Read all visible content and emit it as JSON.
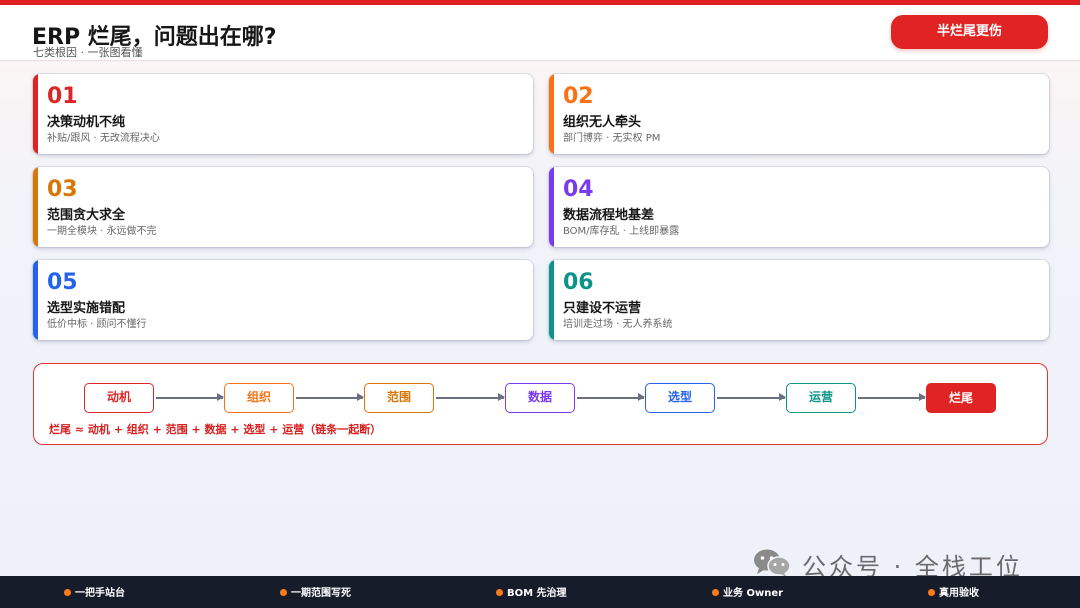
{
  "header": {
    "title": "ERP 烂尾，问题出在哪?",
    "subtitle": "七类根因 · 一张图看懂",
    "button_label": "半烂尾更伤"
  },
  "colors": {
    "accent_red": "#e02424",
    "card_01": "#dc2626",
    "card_02": "#f97316",
    "card_03": "#d97706",
    "card_04": "#7c3aed",
    "card_05": "#2563eb",
    "card_06": "#0d9488"
  },
  "cards": [
    {
      "num": "01",
      "title": "决策动机不纯",
      "desc": "补贴/跟风 · 无改流程决心",
      "color": "#dc2626"
    },
    {
      "num": "02",
      "title": "组织无人牵头",
      "desc": "部门博弈 · 无实权 PM",
      "color": "#f97316"
    },
    {
      "num": "03",
      "title": "范围贪大求全",
      "desc": "一期全模块 · 永远做不完",
      "color": "#d97706"
    },
    {
      "num": "04",
      "title": "数据流程地基差",
      "desc": "BOM/库存乱 · 上线即暴露",
      "color": "#7c3aed"
    },
    {
      "num": "05",
      "title": "选型实施错配",
      "desc": "低价中标 · 顾问不懂行",
      "color": "#2563eb"
    },
    {
      "num": "06",
      "title": "只建设不运营",
      "desc": "培训走过场 · 无人养系统",
      "color": "#0d9488"
    }
  ],
  "flow": {
    "nodes": [
      {
        "label": "动机",
        "color": "#dc2626"
      },
      {
        "label": "组织",
        "color": "#f97316"
      },
      {
        "label": "范围",
        "color": "#d97706"
      },
      {
        "label": "数据",
        "color": "#7c3aed"
      },
      {
        "label": "选型",
        "color": "#2563eb"
      },
      {
        "label": "运营",
        "color": "#0d9488"
      },
      {
        "label": "烂尾",
        "color": "#e02424"
      }
    ],
    "note": "烂尾 ≈ 动机 + 组织 + 范围 + 数据 + 选型 + 运营（链条一起断）"
  },
  "watermark": {
    "icon": "wechat-icon",
    "text": "公众号 · 全栈工位"
  },
  "footer": {
    "items": [
      "一把手站台",
      "一期范围写死",
      "BOM 先治理",
      "业务 Owner",
      "真用验收"
    ]
  }
}
